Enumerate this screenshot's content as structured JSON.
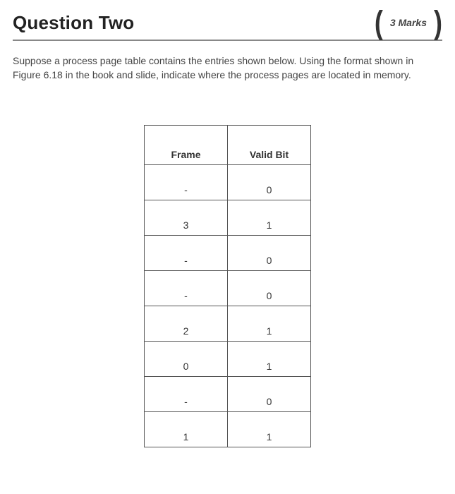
{
  "header": {
    "title": "Question Two",
    "marks_label": "3 Marks",
    "bracket_left": "(",
    "bracket_right": ")"
  },
  "prompt": "Suppose a process page table contains the entries shown below. Using the format shown in Figure 6.18 in the book and slide, indicate where the process pages are located in memory.",
  "table": {
    "columns": [
      "Frame",
      "Valid Bit"
    ],
    "rows": [
      {
        "frame": "-",
        "valid": "0"
      },
      {
        "frame": "3",
        "valid": "1"
      },
      {
        "frame": "-",
        "valid": "0"
      },
      {
        "frame": "-",
        "valid": "0"
      },
      {
        "frame": "2",
        "valid": "1"
      },
      {
        "frame": "0",
        "valid": "1"
      },
      {
        "frame": "-",
        "valid": "0"
      },
      {
        "frame": "1",
        "valid": "1"
      }
    ]
  },
  "chart_data": {
    "type": "table",
    "title": "Process Page Table",
    "columns": [
      "Frame",
      "Valid Bit"
    ],
    "rows": [
      [
        "-",
        0
      ],
      [
        3,
        1
      ],
      [
        "-",
        0
      ],
      [
        "-",
        0
      ],
      [
        2,
        1
      ],
      [
        0,
        1
      ],
      [
        "-",
        0
      ],
      [
        1,
        1
      ]
    ]
  }
}
